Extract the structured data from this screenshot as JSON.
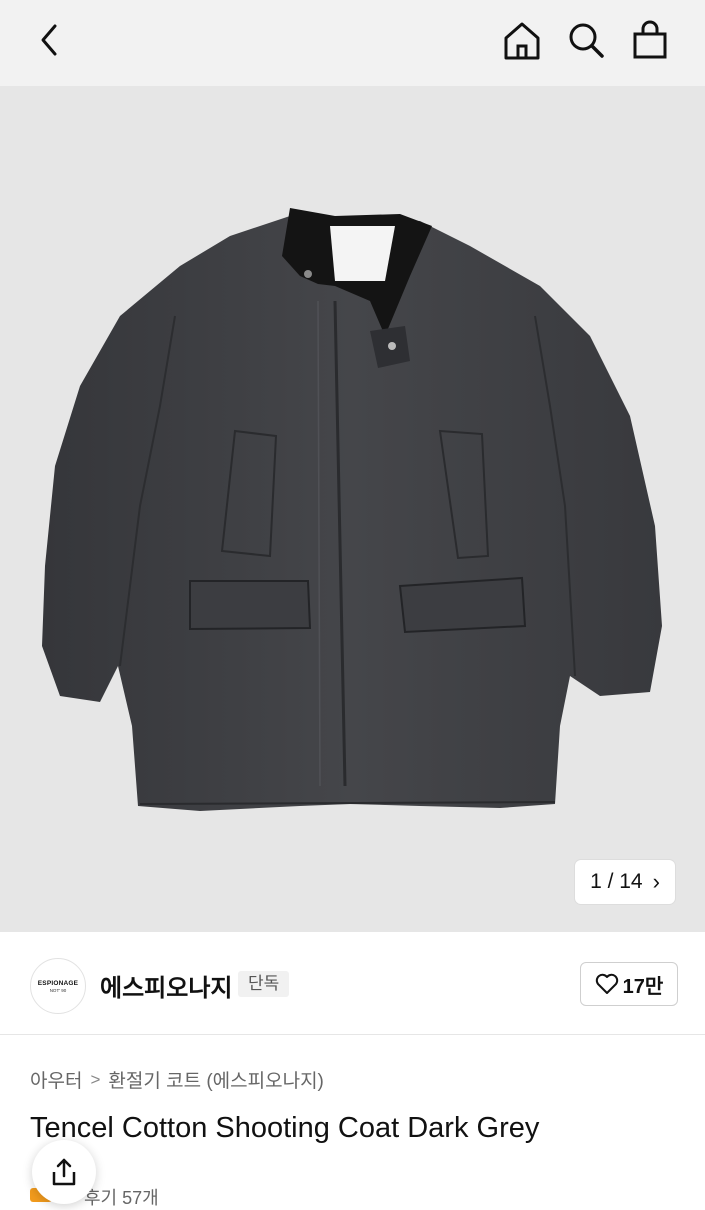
{
  "header": {
    "back_icon": "chevron-left-icon",
    "home_icon": "home-icon",
    "search_icon": "search-icon",
    "bag_icon": "shopping-bag-icon"
  },
  "gallery": {
    "counter": "1 / 14",
    "image": "dark grey coat with black corduroy collar"
  },
  "brand": {
    "logo_line1": "ESPIONAGE",
    "logo_line2": "NOT' 90",
    "name": "에스피오나지",
    "badge": "단독",
    "likes": "17만"
  },
  "breadcrumb": {
    "category": "아우터",
    "separator": ">",
    "subcategory": "환절기 코트 (에스피오나지)"
  },
  "product": {
    "title": "Tencel Cotton Shooting Coat Dark Grey",
    "reviews": "후기 57개"
  },
  "colors": {
    "accent_orange": "#f29b1d",
    "coat": "#3d3e41",
    "collar": "#141414",
    "gallery_bg": "#e6e6e6"
  }
}
